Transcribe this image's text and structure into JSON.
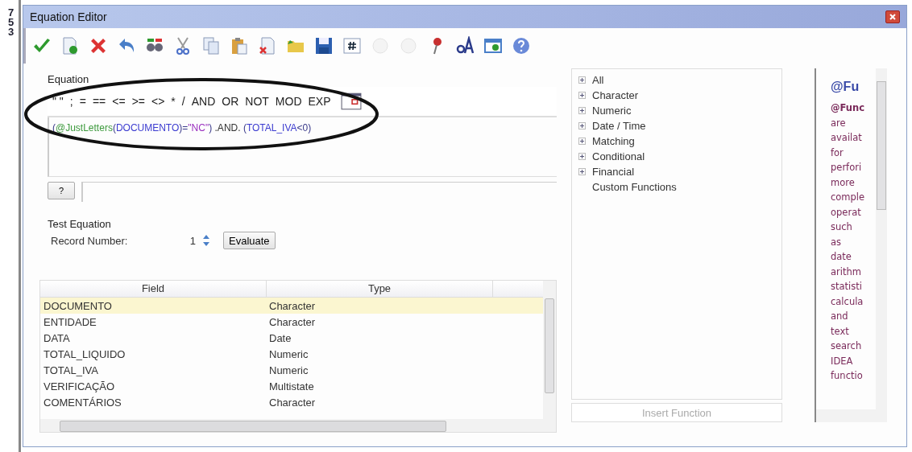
{
  "edge_digits": [
    "7",
    "5",
    "3"
  ],
  "window": {
    "title": "Equation Editor"
  },
  "toolbar": [
    {
      "kind": "check",
      "disabled": false
    },
    {
      "kind": "doc-check",
      "disabled": false
    },
    {
      "kind": "cross",
      "disabled": false
    },
    {
      "kind": "undo",
      "disabled": false
    },
    {
      "kind": "binoculars",
      "disabled": false
    },
    {
      "kind": "scissors",
      "disabled": false
    },
    {
      "kind": "copy",
      "disabled": false
    },
    {
      "kind": "paste",
      "disabled": false
    },
    {
      "kind": "doc-cross",
      "disabled": false
    },
    {
      "kind": "folder",
      "disabled": false
    },
    {
      "kind": "save",
      "disabled": false
    },
    {
      "kind": "hash",
      "disabled": false
    },
    {
      "kind": "circle",
      "disabled": true
    },
    {
      "kind": "circle",
      "disabled": true
    },
    {
      "kind": "pin",
      "disabled": false
    },
    {
      "kind": "font",
      "disabled": false
    },
    {
      "kind": "window",
      "disabled": false
    },
    {
      "kind": "help",
      "disabled": false
    }
  ],
  "equation": {
    "label": "Equation",
    "operators": [
      "\" \"",
      ";",
      "=",
      "==",
      "<=",
      ">=",
      "<>",
      "*",
      "/",
      "AND",
      "OR",
      "NOT",
      "MOD",
      "EXP"
    ],
    "tokens": [
      {
        "kind": "paren",
        "text": "("
      },
      {
        "kind": "func",
        "text": "@JustLetters"
      },
      {
        "kind": "paren",
        "text": "("
      },
      {
        "kind": "field",
        "text": "DOCUMENTO"
      },
      {
        "kind": "paren",
        "text": ")="
      },
      {
        "kind": "string",
        "text": "\"NC\""
      },
      {
        "kind": "paren",
        "text": ")"
      },
      {
        "kind": "op",
        "text": " .AND. "
      },
      {
        "kind": "paren",
        "text": "("
      },
      {
        "kind": "field",
        "text": "TOTAL_IVA"
      },
      {
        "kind": "paren",
        "text": "<0)"
      }
    ],
    "help_button": "?"
  },
  "test": {
    "title": "Test Equation",
    "record_label": "Record Number:",
    "record_value": "1",
    "evaluate": "Evaluate"
  },
  "table": {
    "columns": [
      "Field",
      "Type"
    ],
    "rows": [
      {
        "field": "DOCUMENTO",
        "type": "Character",
        "selected": true
      },
      {
        "field": "ENTIDADE",
        "type": "Character",
        "selected": false
      },
      {
        "field": "DATA",
        "type": "Date",
        "selected": false
      },
      {
        "field": "TOTAL_LIQUIDO",
        "type": "Numeric",
        "selected": false
      },
      {
        "field": "TOTAL_IVA",
        "type": "Numeric",
        "selected": false
      },
      {
        "field": "VERIFICAÇÃO",
        "type": "Multistate",
        "selected": false
      },
      {
        "field": "COMENTÁRIOS",
        "type": "Character",
        "selected": false
      }
    ]
  },
  "functions": {
    "items": [
      {
        "label": "All",
        "expanded": false
      },
      {
        "label": "Character",
        "expanded": false
      },
      {
        "label": "Numeric",
        "expanded": false
      },
      {
        "label": "Date / Time",
        "expanded": false
      },
      {
        "label": "Matching",
        "expanded": false
      },
      {
        "label": "Conditional",
        "expanded": false
      },
      {
        "label": "Financial",
        "expanded": false
      },
      {
        "label": "Custom Functions"
      }
    ],
    "insert_button": "Insert Function"
  },
  "help": {
    "heading": "@Fu",
    "text": "**@Func**\nare\navailat\nfor\nperfori\nmore\ncomple\noperat\nsuch\nas\ndate\narithm\nstatisti\ncalcula\nand\ntext\nsearch\nIDEA\nfunctio"
  }
}
